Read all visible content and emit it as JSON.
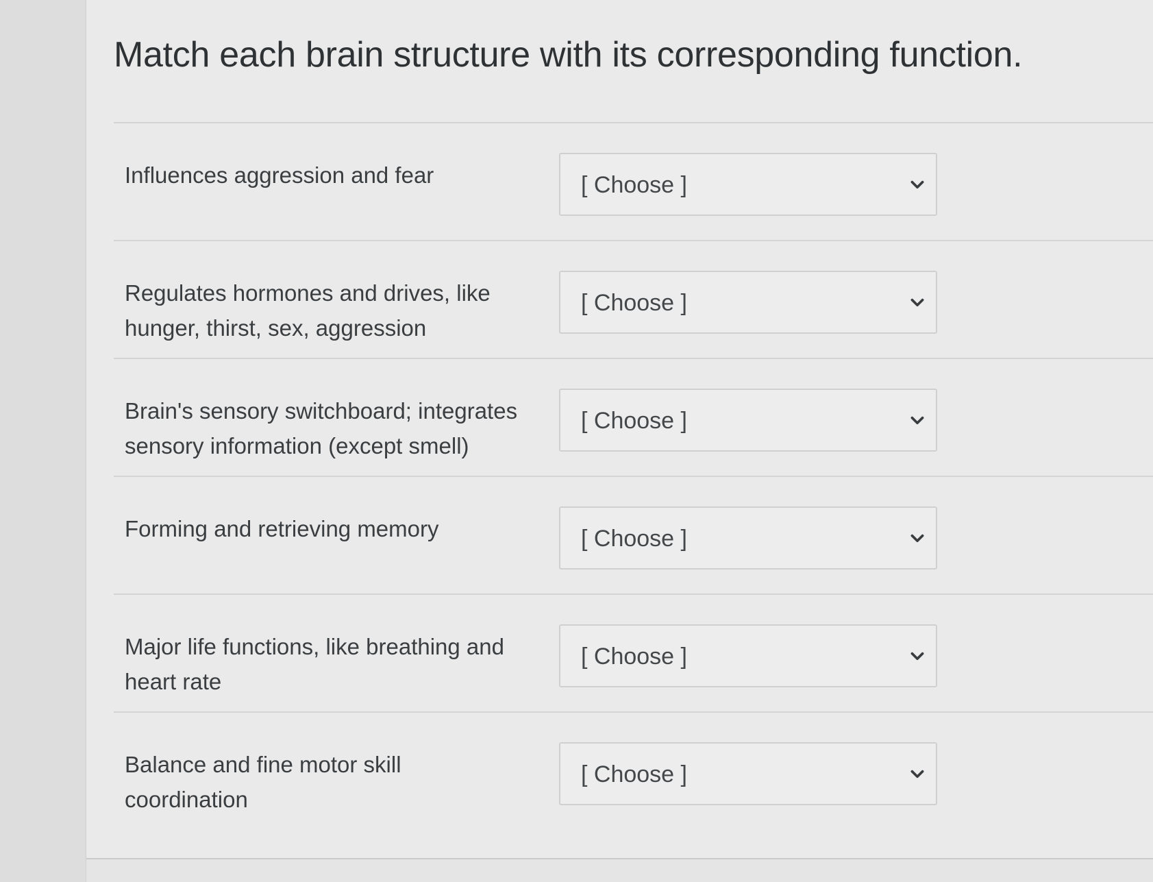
{
  "question": {
    "title": "Match each brain structure with its corresponding function."
  },
  "matches": [
    {
      "prompt": "Influences aggression and fear",
      "selected": "[ Choose ]"
    },
    {
      "prompt": "Regulates hormones and drives, like hunger, thirst, sex, aggression",
      "selected": "[ Choose ]"
    },
    {
      "prompt": "Brain's sensory switchboard; integrates sensory information (except smell)",
      "selected": "[ Choose ]"
    },
    {
      "prompt": "Forming and retrieving memory",
      "selected": "[ Choose ]"
    },
    {
      "prompt": "Major life functions, like breathing and heart rate",
      "selected": "[ Choose ]"
    },
    {
      "prompt": "Balance and fine motor skill coordination",
      "selected": "[ Choose ]"
    }
  ],
  "icons": {
    "dropdown": "chevron-down-icon"
  },
  "colors": {
    "page_background": "#e4e5e4",
    "card_background": "#e9eae9",
    "text": "#3a3d3f",
    "border": "#cfd0cf"
  }
}
